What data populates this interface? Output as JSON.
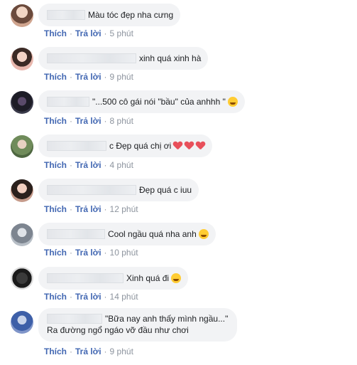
{
  "comments": [
    {
      "text": "Màu tóc đẹp nha cưng",
      "like": "Thích",
      "reply": "Trả lời",
      "time": "5 phút",
      "avatar_color": "#d9b8a4"
    },
    {
      "text": "xinh quá xinh hà",
      "like": "Thích",
      "reply": "Trả lời",
      "time": "9 phút",
      "avatar_color": "#e1a9a2"
    },
    {
      "text": "\"...500 cô gái nói \"bầu\" của anhhh \"",
      "like": "Thích",
      "reply": "Trả lời",
      "time": "8 phút",
      "avatar_color": "#2c2d3a"
    },
    {
      "text": "c Đẹp quá chị ơi",
      "like": "Thích",
      "reply": "Trả lời",
      "time": "4 phút",
      "avatar_color": "#6f8b5a"
    },
    {
      "text": "Đẹp quá c iuu",
      "like": "Thích",
      "reply": "Trả lời",
      "time": "12 phút",
      "avatar_color": "#c59a8a"
    },
    {
      "text": "Cool ngầu quá nha anh",
      "like": "Thích",
      "reply": "Trả lời",
      "time": "10 phút",
      "avatar_color": "#9aa3ad"
    },
    {
      "text": "Xinh quá đi",
      "like": "Thích",
      "reply": "Trả lời",
      "time": "14 phút",
      "avatar_color": "#232323"
    },
    {
      "text": "\"Bữa nay anh thấy mình ngầu...\"",
      "text2": "Ra đường ngổ ngáo vỡ đầu như chơi",
      "like": "Thích",
      "reply": "Trả lời",
      "time": "9 phút",
      "avatar_color": "#3d5fa8"
    }
  ],
  "icons": {
    "laugh": "laughing-emoji-icon",
    "heart": "heart-emoji-icon",
    "hearteyes": "heart-eyes-emoji-icon"
  }
}
